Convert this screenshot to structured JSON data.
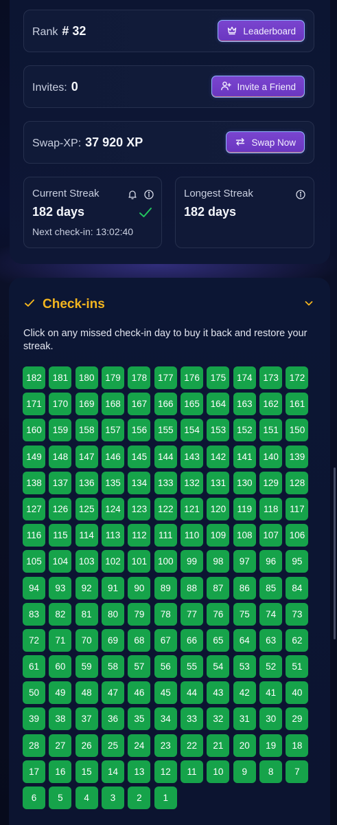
{
  "rank": {
    "label": "Rank",
    "value": "# 32",
    "button": "Leaderboard",
    "button_icon": "crown-icon"
  },
  "invites": {
    "label": "Invites:",
    "value": "0",
    "button": "Invite a Friend",
    "button_icon": "user-plus-icon"
  },
  "swap": {
    "label": "Swap-XP:",
    "value": "37 920 XP",
    "button": "Swap Now",
    "button_icon": "swap-arrows-icon"
  },
  "current_streak": {
    "title": "Current Streak",
    "days": "182 days",
    "next_checkin": "Next check-in: 13:02:40",
    "icons": [
      "bell-icon",
      "info-icon",
      "check-icon"
    ]
  },
  "longest_streak": {
    "title": "Longest Streak",
    "days": "182 days",
    "icons": [
      "info-icon"
    ]
  },
  "checkins": {
    "title": "Check-ins",
    "description": "Click on any missed check-in day to buy it back and restore your streak.",
    "total_days": 182,
    "day_color": "#16a34a",
    "accent_color": "#f3b51f"
  }
}
